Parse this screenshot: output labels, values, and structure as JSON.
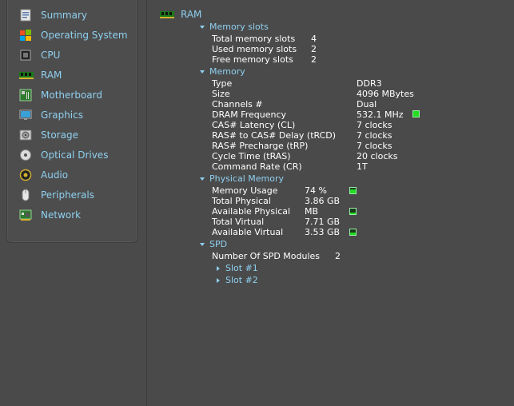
{
  "sidebar": {
    "items": [
      {
        "label": "Summary",
        "icon": "summary-icon"
      },
      {
        "label": "Operating System",
        "icon": "windows-icon"
      },
      {
        "label": "CPU",
        "icon": "cpu-icon"
      },
      {
        "label": "RAM",
        "icon": "ram-icon"
      },
      {
        "label": "Motherboard",
        "icon": "motherboard-icon"
      },
      {
        "label": "Graphics",
        "icon": "monitor-icon"
      },
      {
        "label": "Storage",
        "icon": "storage-icon"
      },
      {
        "label": "Optical Drives",
        "icon": "optical-drive-icon"
      },
      {
        "label": "Audio",
        "icon": "speaker-icon"
      },
      {
        "label": "Peripherals",
        "icon": "mouse-icon"
      },
      {
        "label": "Network",
        "icon": "network-icon"
      }
    ]
  },
  "page": {
    "title": "RAM"
  },
  "sections": {
    "memory_slots": {
      "title": "Memory slots",
      "rows": [
        {
          "label": "Total memory slots",
          "value": "4"
        },
        {
          "label": "Used memory slots",
          "value": "2"
        },
        {
          "label": "Free memory slots",
          "value": "2"
        }
      ]
    },
    "memory": {
      "title": "Memory",
      "rows": [
        {
          "label": "Type",
          "value": "DDR3"
        },
        {
          "label": "Size",
          "value": "4096 MBytes"
        },
        {
          "label": "Channels #",
          "value": "Dual"
        },
        {
          "label": "DRAM Frequency",
          "value": "532.1 MHz"
        },
        {
          "label": "CAS# Latency (CL)",
          "value": "7 clocks"
        },
        {
          "label": "RAS# to CAS# Delay (tRCD)",
          "value": "7 clocks"
        },
        {
          "label": "RAS# Precharge (tRP)",
          "value": "7 clocks"
        },
        {
          "label": "Cycle Time (tRAS)",
          "value": "20 clocks"
        },
        {
          "label": "Command Rate (CR)",
          "value": "1T"
        }
      ]
    },
    "physical_memory": {
      "title": "Physical Memory",
      "rows": [
        {
          "label": "Memory Usage",
          "value": "74 %",
          "level": 0.74
        },
        {
          "label": "Total Physical",
          "value": "3.86 GB"
        },
        {
          "label": "Available Physical",
          "value": "MB",
          "level": 0.26
        },
        {
          "label": "Total Virtual",
          "value": "7.71 GB"
        },
        {
          "label": "Available Virtual",
          "value": "3.53 GB",
          "level": 0.46
        }
      ]
    },
    "spd": {
      "title": "SPD",
      "modules_label": "Number Of SPD Modules",
      "modules_value": "2",
      "slots": [
        "Slot #1",
        "Slot #2"
      ]
    }
  },
  "colors": {
    "accent": "#8fd0f0",
    "background": "#4a4a4a",
    "gauge": "#22dd22"
  }
}
